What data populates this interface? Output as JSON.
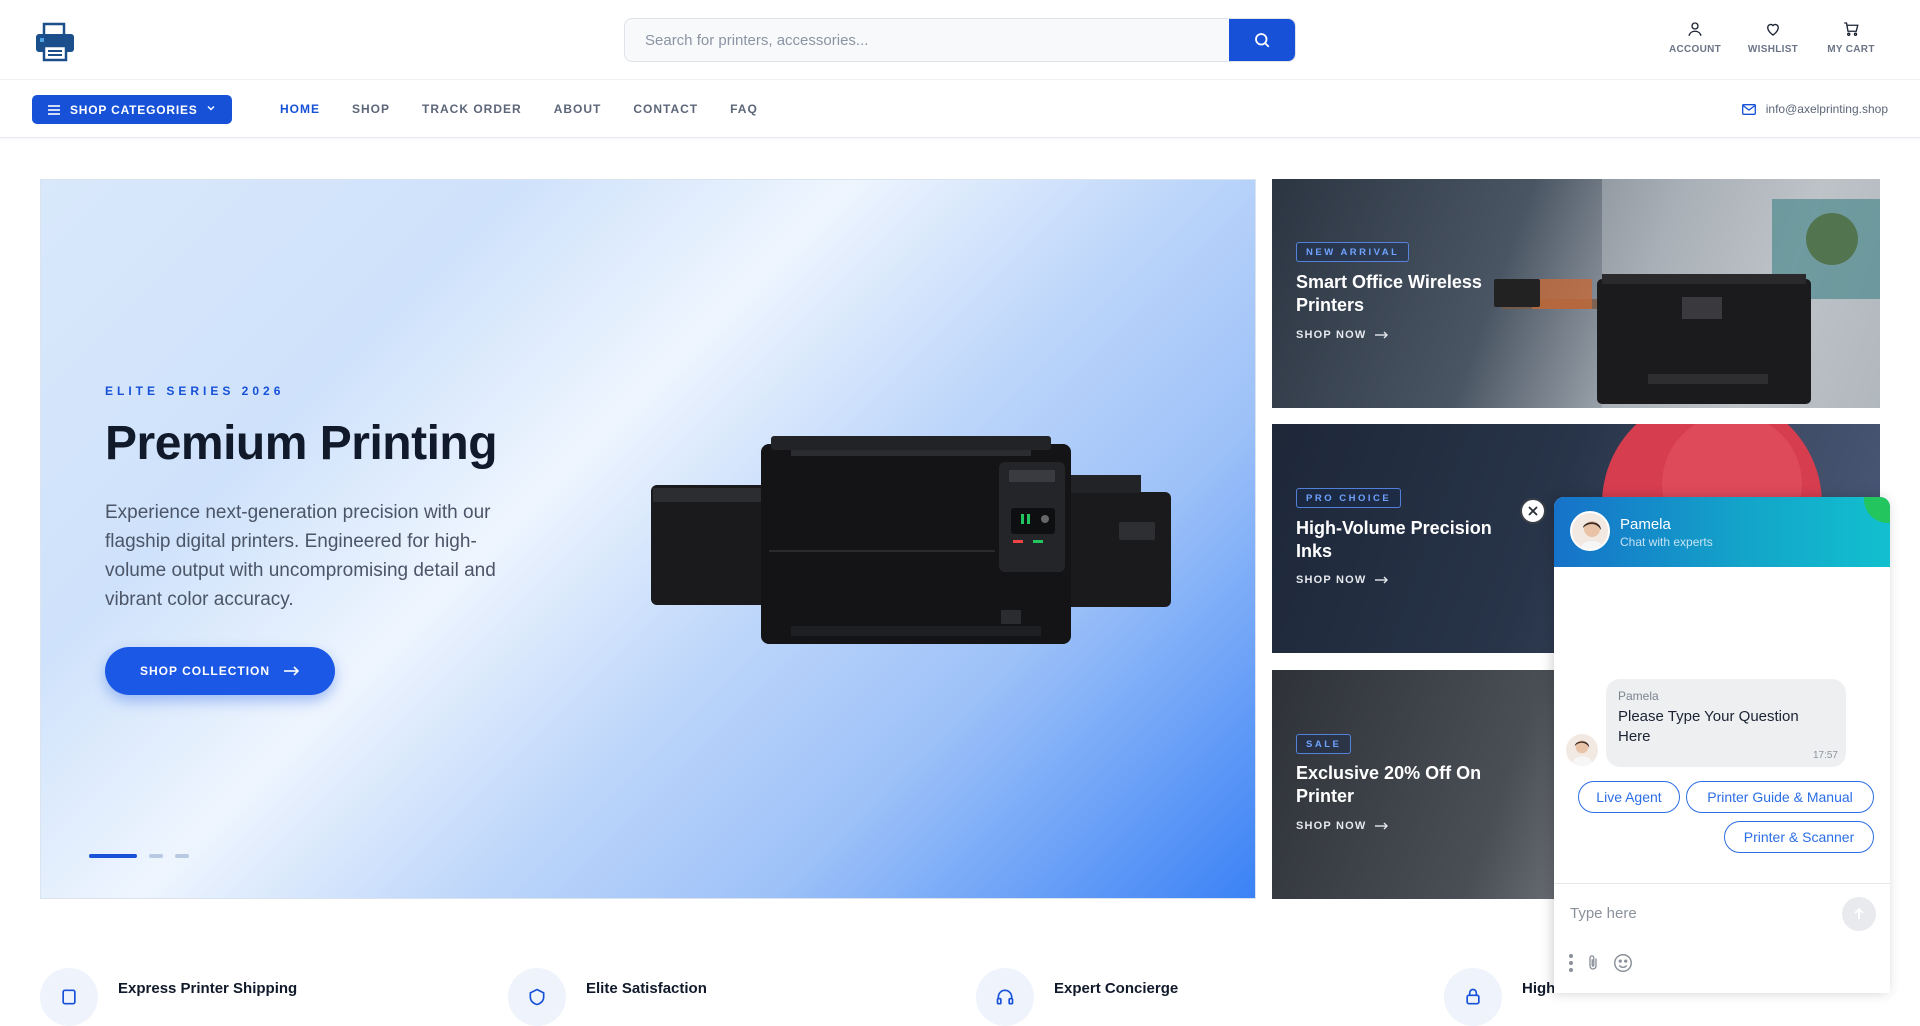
{
  "header": {
    "search_placeholder": "Search for printers, accessories...",
    "actions": [
      {
        "label": "ACCOUNT",
        "icon": "user-icon"
      },
      {
        "label": "WISHLIST",
        "icon": "heart-icon"
      },
      {
        "label": "MY CART",
        "icon": "cart-icon"
      }
    ]
  },
  "nav": {
    "categories_label": "SHOP CATEGORIES",
    "links": [
      "HOME",
      "SHOP",
      "TRACK ORDER",
      "ABOUT",
      "CONTACT",
      "FAQ"
    ],
    "active": "HOME",
    "email": "info@axelprinting.shop"
  },
  "hero": {
    "eyebrow": "ELITE SERIES 2026",
    "title": "Premium Printing",
    "description": "Experience next-generation precision with our flagship digital printers. Engineered for high-volume output with uncompromising detail and vibrant color accuracy.",
    "cta": "SHOP COLLECTION",
    "slides": 3,
    "active_slide": 1
  },
  "promos": [
    {
      "badge": "NEW ARRIVAL",
      "title": "Smart Office Wireless Printers",
      "link": "SHOP NOW"
    },
    {
      "badge": "PRO CHOICE",
      "title": "High-Volume Precision Inks",
      "link": "SHOP NOW"
    },
    {
      "badge": "SALE",
      "title": "Exclusive 20% Off On Printer",
      "link": "SHOP NOW"
    }
  ],
  "features": [
    {
      "title": "Express Printer Shipping",
      "icon": "box-icon"
    },
    {
      "title": "Elite Satisfaction",
      "icon": "shield-icon"
    },
    {
      "title": "Expert Concierge",
      "icon": "headset-icon"
    },
    {
      "title": "High",
      "icon": "lock-icon"
    }
  ],
  "chat": {
    "agent_name": "Pamela",
    "agent_subtitle": "Chat with experts",
    "message": {
      "sender": "Pamela",
      "text": "Please Type Your Question Here",
      "time": "17:57"
    },
    "quick_replies": [
      "Live Agent",
      "Printer Guide & Manual",
      "Printer & Scanner"
    ],
    "input_placeholder": "Type here"
  },
  "colors": {
    "brand": "#1651d8",
    "chat_header": "#13a3c9",
    "online": "#22c55e"
  }
}
